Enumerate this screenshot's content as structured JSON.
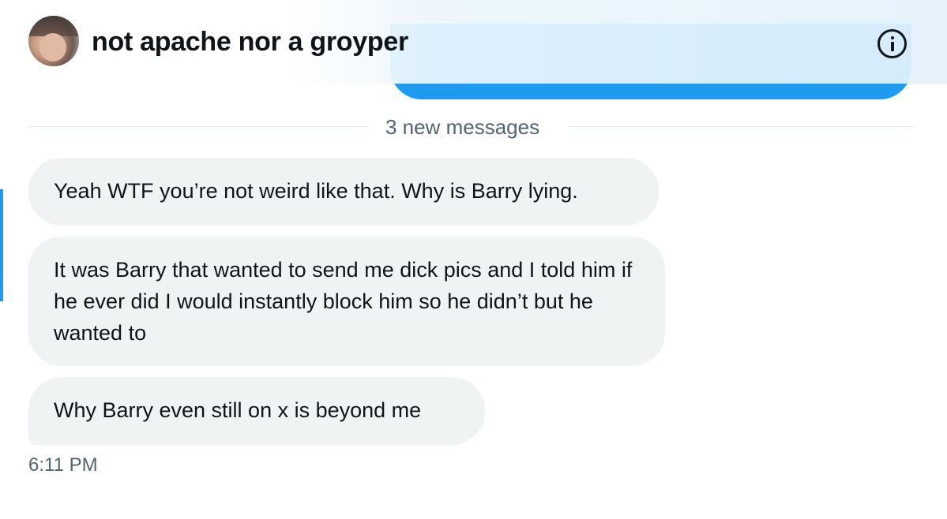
{
  "header": {
    "title": "not apache nor a groyper",
    "avatar_icon": "user-avatar",
    "info_icon": "info-circle-icon"
  },
  "divider": {
    "label": "3 new messages"
  },
  "messages": [
    {
      "text": "Yeah WTF you’re not weird like that. Why is Barry lying."
    },
    {
      "text": "It was Barry that wanted to send me dick pics and I told him if he ever did I would instantly block him so he didn’t but he wanted to"
    },
    {
      "text": "Why Barry even still on x is beyond me"
    }
  ],
  "timestamp": "6:11 PM",
  "colors": {
    "accent": "#1d9bf0",
    "received_bubble": "#eff3f4",
    "text": "#0f1419",
    "muted": "#536471"
  }
}
